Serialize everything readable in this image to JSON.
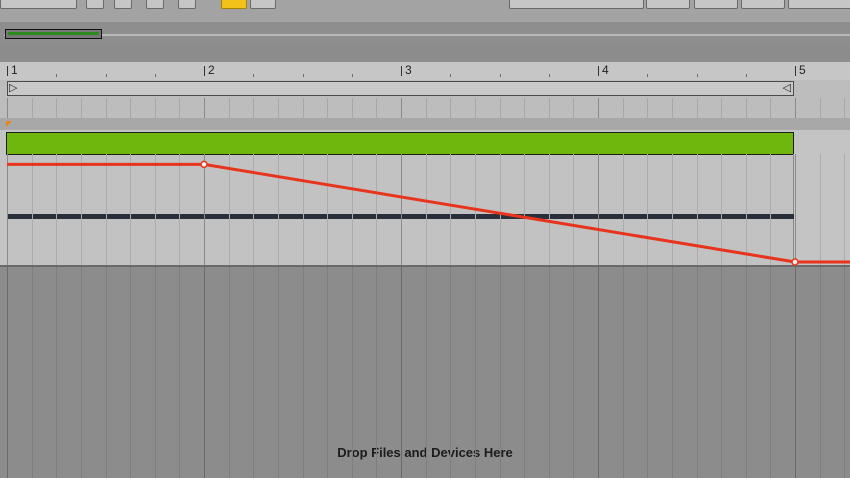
{
  "ruler": {
    "bars": [
      "1",
      "2",
      "3",
      "4",
      "5"
    ]
  },
  "loop": {
    "start_glyph": "▷",
    "end_glyph": "◁"
  },
  "clip": {
    "color": "#6fb60d"
  },
  "automation": {
    "color": "#e8341c",
    "breakpoints": [
      {
        "bar": 1,
        "value": 0.93
      },
      {
        "bar": 2,
        "value": 0.93
      },
      {
        "bar": 5,
        "value": 0.0
      },
      {
        "bar": 5.3,
        "value": 0.0
      }
    ]
  },
  "empty_area": {
    "drop_label": "Drop Files and Devices Here"
  },
  "toolbar": {
    "active_button_color": "#f2c21b"
  }
}
